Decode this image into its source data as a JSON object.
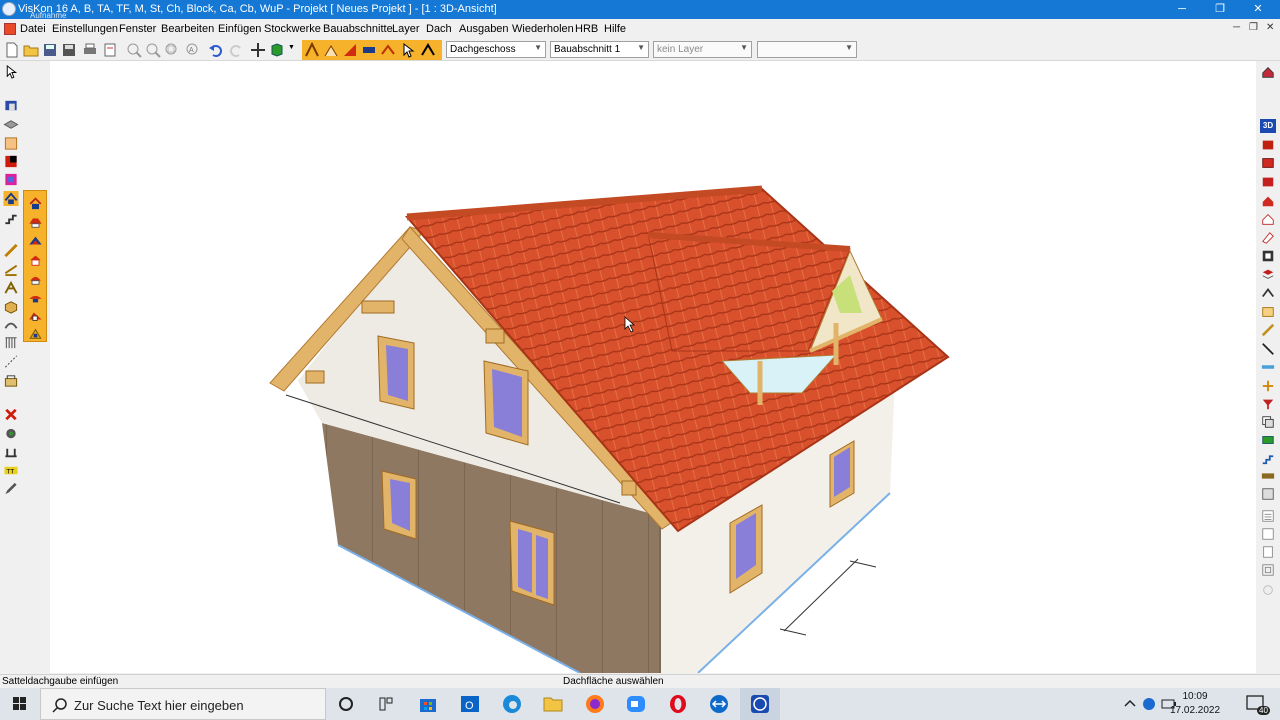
{
  "window": {
    "title": "VisKon 16 A, B, TA, TF, M, St, Ch, Block, Ca, Cb, WuP - Projekt [ Neues Projekt ] - [1 : 3D-Ansicht]",
    "overlay_caption": "Aufnahme",
    "minimize": "─",
    "restore": "❐",
    "close": "✕"
  },
  "menu": {
    "items": [
      "Datei",
      "Einstellungen",
      "Fenster",
      "Bearbeiten",
      "Einfügen",
      "Stockwerke",
      "Bauabschnitte",
      "Layer",
      "Dach",
      "Ausgaben",
      "Wiederholen",
      "HRB",
      "Hilfe"
    ],
    "mdi_minimize": "─",
    "mdi_restore": "❐",
    "mdi_close": "✕"
  },
  "toolbar": {
    "floor_select": "Dachgeschoss",
    "section_select": "Bauabschnitt 1",
    "layer_select": "kein Layer",
    "extra_select": ""
  },
  "view": {
    "mode": "3D-Ansicht",
    "right_badge": "3D"
  },
  "status": {
    "left": "Satteldachgaube einfügen",
    "middle": "Dachfläche auswählen"
  },
  "taskbar": {
    "search_placeholder": "Zur Suche Text hier eingeben",
    "time": "10:09",
    "date": "17.02.2022",
    "notification_count": "40"
  },
  "colors": {
    "titlebar": "#1478d4",
    "roof_tiles": "#d9512c",
    "timber": "#e2b46a",
    "wall_render": "#eeeae4",
    "cladding": "#8a7460",
    "window_glass": "#8a7fd8",
    "tool_highlight": "#f5b22a"
  }
}
